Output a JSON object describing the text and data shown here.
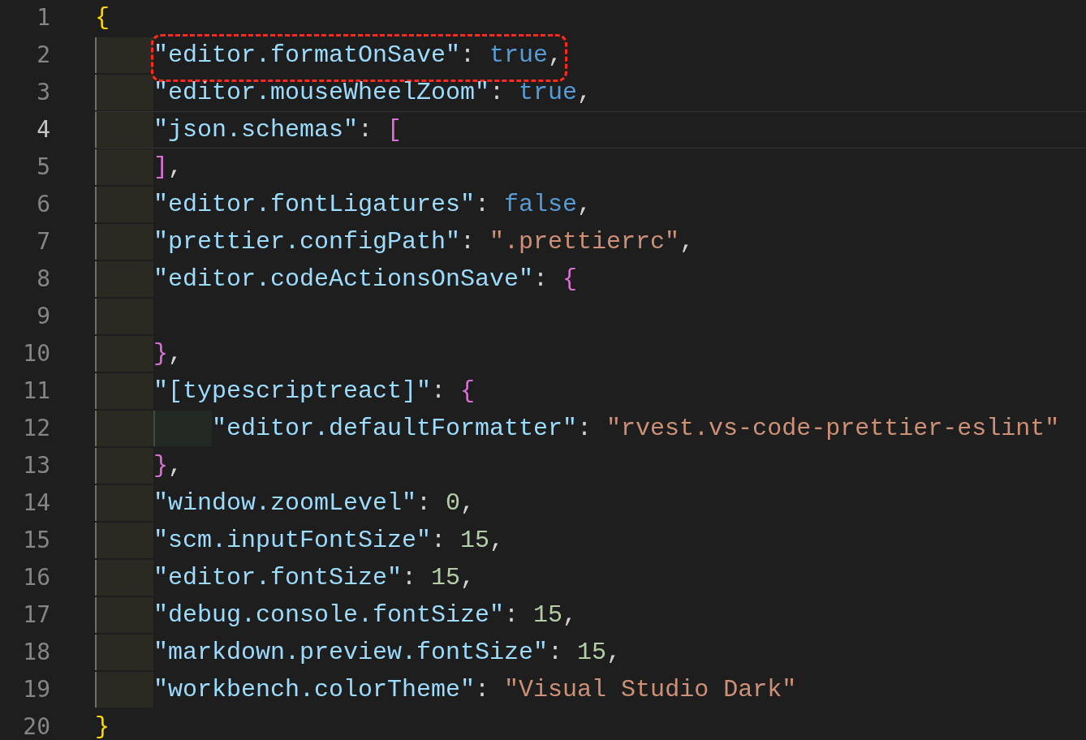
{
  "editor": {
    "lines": [
      {
        "number": "1",
        "current": false,
        "tokens": [
          {
            "kind": "brace1",
            "text": "{"
          }
        ]
      },
      {
        "number": "2",
        "current": false,
        "boxed": true,
        "tokens": [
          {
            "kind": "indent"
          },
          {
            "kind": "key",
            "text": "\"editor.formatOnSave\""
          },
          {
            "kind": "punct",
            "text": ": "
          },
          {
            "kind": "keyword",
            "text": "true"
          },
          {
            "kind": "punct",
            "text": ","
          }
        ]
      },
      {
        "number": "3",
        "current": false,
        "tokens": [
          {
            "kind": "indent"
          },
          {
            "kind": "key",
            "text": "\"editor.mouseWheelZoom\""
          },
          {
            "kind": "punct",
            "text": ": "
          },
          {
            "kind": "keyword",
            "text": "true"
          },
          {
            "kind": "punct",
            "text": ","
          }
        ]
      },
      {
        "number": "4",
        "current": true,
        "tokens": [
          {
            "kind": "indent"
          },
          {
            "kind": "key",
            "text": "\"json.schemas\""
          },
          {
            "kind": "punct",
            "text": ": "
          },
          {
            "kind": "brace2",
            "text": "["
          }
        ]
      },
      {
        "number": "5",
        "current": false,
        "tokens": [
          {
            "kind": "indent"
          },
          {
            "kind": "brace2",
            "text": "]"
          },
          {
            "kind": "punct",
            "text": ","
          }
        ]
      },
      {
        "number": "6",
        "current": false,
        "tokens": [
          {
            "kind": "indent"
          },
          {
            "kind": "key",
            "text": "\"editor.fontLigatures\""
          },
          {
            "kind": "punct",
            "text": ": "
          },
          {
            "kind": "keyword",
            "text": "false"
          },
          {
            "kind": "punct",
            "text": ","
          }
        ]
      },
      {
        "number": "7",
        "current": false,
        "tokens": [
          {
            "kind": "indent"
          },
          {
            "kind": "key",
            "text": "\"prettier.configPath\""
          },
          {
            "kind": "punct",
            "text": ": "
          },
          {
            "kind": "string",
            "text": "\".prettierrc\""
          },
          {
            "kind": "punct",
            "text": ","
          }
        ]
      },
      {
        "number": "8",
        "current": false,
        "tokens": [
          {
            "kind": "indent"
          },
          {
            "kind": "key",
            "text": "\"editor.codeActionsOnSave\""
          },
          {
            "kind": "punct",
            "text": ": "
          },
          {
            "kind": "brace2",
            "text": "{"
          }
        ]
      },
      {
        "number": "9",
        "current": false,
        "tokens": [
          {
            "kind": "indent"
          }
        ]
      },
      {
        "number": "10",
        "current": false,
        "tokens": [
          {
            "kind": "indent"
          },
          {
            "kind": "brace2",
            "text": "}"
          },
          {
            "kind": "punct",
            "text": ","
          }
        ]
      },
      {
        "number": "11",
        "current": false,
        "tokens": [
          {
            "kind": "indent"
          },
          {
            "kind": "key",
            "text": "\"[typescriptreact]\""
          },
          {
            "kind": "punct",
            "text": ": "
          },
          {
            "kind": "brace2",
            "text": "{"
          }
        ]
      },
      {
        "number": "12",
        "current": false,
        "tokens": [
          {
            "kind": "indent"
          },
          {
            "kind": "indent2"
          },
          {
            "kind": "key",
            "text": "\"editor.defaultFormatter\""
          },
          {
            "kind": "punct",
            "text": ": "
          },
          {
            "kind": "string",
            "text": "\"rvest.vs-code-prettier-eslint\""
          }
        ]
      },
      {
        "number": "13",
        "current": false,
        "tokens": [
          {
            "kind": "indent"
          },
          {
            "kind": "brace2",
            "text": "}"
          },
          {
            "kind": "punct",
            "text": ","
          }
        ]
      },
      {
        "number": "14",
        "current": false,
        "tokens": [
          {
            "kind": "indent"
          },
          {
            "kind": "key",
            "text": "\"window.zoomLevel\""
          },
          {
            "kind": "punct",
            "text": ": "
          },
          {
            "kind": "number",
            "text": "0"
          },
          {
            "kind": "punct",
            "text": ","
          }
        ]
      },
      {
        "number": "15",
        "current": false,
        "tokens": [
          {
            "kind": "indent"
          },
          {
            "kind": "key",
            "text": "\"scm.inputFontSize\""
          },
          {
            "kind": "punct",
            "text": ": "
          },
          {
            "kind": "number",
            "text": "15"
          },
          {
            "kind": "punct",
            "text": ","
          }
        ]
      },
      {
        "number": "16",
        "current": false,
        "tokens": [
          {
            "kind": "indent"
          },
          {
            "kind": "key",
            "text": "\"editor.fontSize\""
          },
          {
            "kind": "punct",
            "text": ": "
          },
          {
            "kind": "number",
            "text": "15"
          },
          {
            "kind": "punct",
            "text": ","
          }
        ]
      },
      {
        "number": "17",
        "current": false,
        "tokens": [
          {
            "kind": "indent"
          },
          {
            "kind": "key",
            "text": "\"debug.console.fontSize\""
          },
          {
            "kind": "punct",
            "text": ": "
          },
          {
            "kind": "number",
            "text": "15"
          },
          {
            "kind": "punct",
            "text": ","
          }
        ]
      },
      {
        "number": "18",
        "current": false,
        "tokens": [
          {
            "kind": "indent"
          },
          {
            "kind": "key",
            "text": "\"markdown.preview.fontSize\""
          },
          {
            "kind": "punct",
            "text": ": "
          },
          {
            "kind": "number",
            "text": "15"
          },
          {
            "kind": "punct",
            "text": ","
          }
        ]
      },
      {
        "number": "19",
        "current": false,
        "tokens": [
          {
            "kind": "indent"
          },
          {
            "kind": "key",
            "text": "\"workbench.colorTheme\""
          },
          {
            "kind": "punct",
            "text": ": "
          },
          {
            "kind": "string",
            "text": "\"Visual Studio Dark\""
          }
        ]
      },
      {
        "number": "20",
        "current": false,
        "tokens": [
          {
            "kind": "brace1",
            "text": "}"
          }
        ]
      }
    ]
  }
}
